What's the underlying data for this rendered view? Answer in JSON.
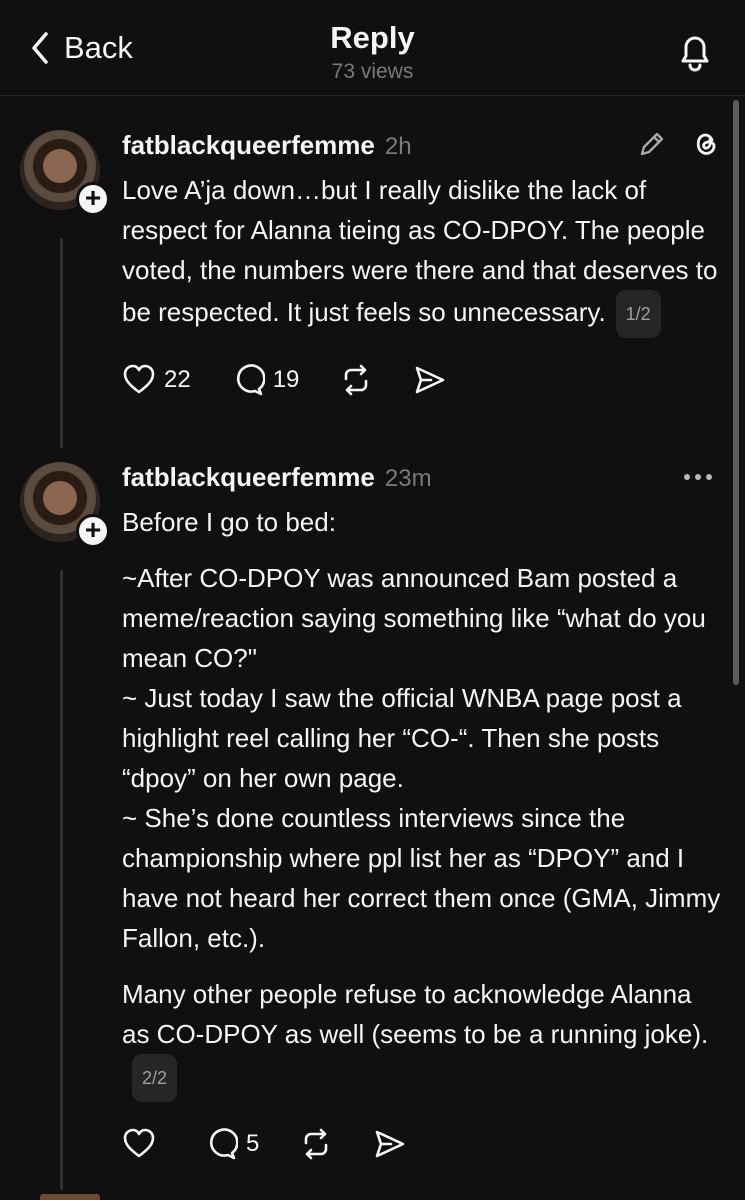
{
  "header": {
    "back_label": "Back",
    "title": "Reply",
    "subtitle": "73 views"
  },
  "posts": [
    {
      "username": "fatblackqueerfemme",
      "time": "2h",
      "paragraphs": [
        "Love A’ja down…but I really dislike the lack of respect for Alanna tieing as CO-DPOY. The people voted, the numbers were there and that deserves to be respected. It just feels so unnecessary."
      ],
      "page_badge": "1/2",
      "likes": "22",
      "comments": "19"
    },
    {
      "username": "fatblackqueerfemme",
      "time": "23m",
      "paragraphs": [
        "Before I go to bed:",
        "~After CO-DPOY was announced Bam posted a meme/reaction saying something like “what do you mean CO?\"",
        "~ Just today I saw the official WNBA page post a highlight reel calling her “CO-“. Then she posts “dpoy” on her own page.",
        "~ She’s done countless interviews since the championship where ppl list her as “DPOY” and I have not heard her correct them once (GMA, Jimmy Fallon, etc.).",
        "Many other people refuse to acknowledge Alanna as CO-DPOY as well (seems to be a running joke)."
      ],
      "page_badge": "2/2",
      "likes": "",
      "comments": "5"
    }
  ],
  "icons": {
    "back": "chevron-left-icon",
    "notify": "bell-icon",
    "edit": "pencil-icon",
    "threads": "threads-logo-icon",
    "more": "more-dots-icon",
    "like": "heart-icon",
    "comment": "comment-icon",
    "repost": "repost-icon",
    "share": "send-icon"
  },
  "colors": {
    "background": "#101010",
    "text": "#f3f5f7",
    "muted": "#7a7a7a"
  }
}
